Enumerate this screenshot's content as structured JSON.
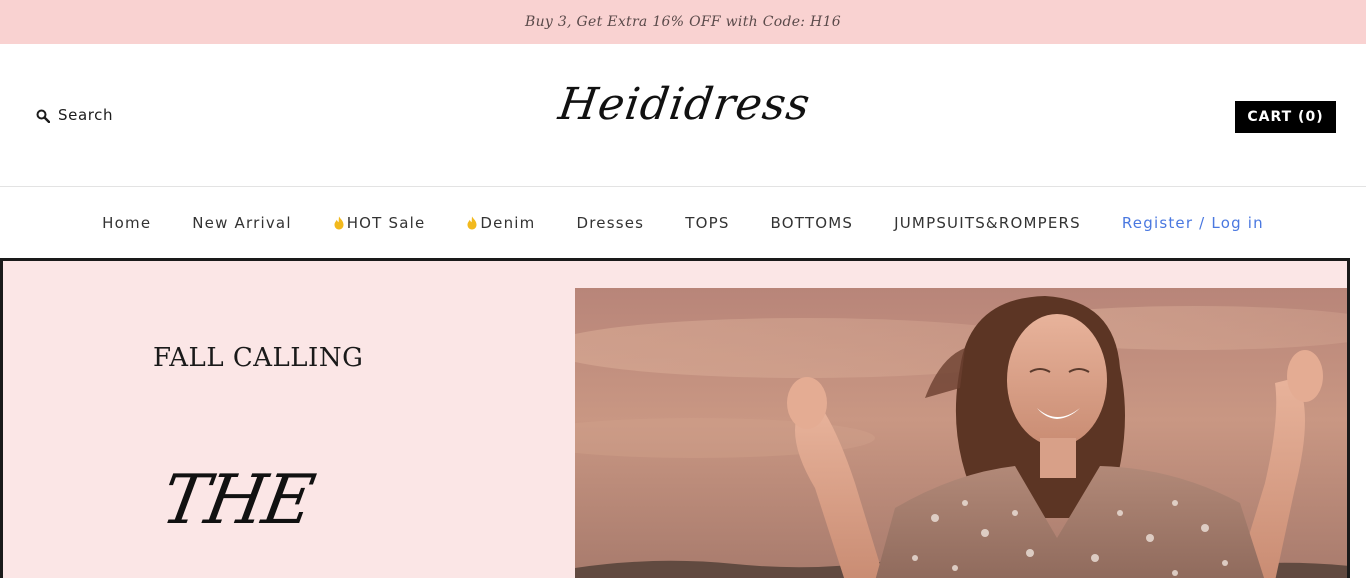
{
  "promo": {
    "text": "Buy 3, Get Extra 16% OFF with Code: H16"
  },
  "header": {
    "search_label": "Search",
    "logo_text": "Heididress",
    "cart_label": "CART (0)"
  },
  "nav": {
    "items": [
      {
        "label": "Home",
        "icon": ""
      },
      {
        "label": "New Arrival",
        "icon": ""
      },
      {
        "label": "HOT Sale",
        "icon": "flame-icon"
      },
      {
        "label": "Denim",
        "icon": "flame-icon"
      },
      {
        "label": "Dresses",
        "icon": ""
      },
      {
        "label": "TOPS",
        "icon": ""
      },
      {
        "label": "BOTTOMS",
        "icon": ""
      },
      {
        "label": "JUMPSUITS&ROMPERS",
        "icon": ""
      }
    ],
    "account_label": "Register / Log in"
  },
  "hero": {
    "heading": "FALL CALLING",
    "script_text": "THE"
  },
  "colors": {
    "promo_bg": "#f9d2d1",
    "hero_bg": "#fbe6e6",
    "account_link": "#4a78e0",
    "flame": "#f2b91d"
  }
}
